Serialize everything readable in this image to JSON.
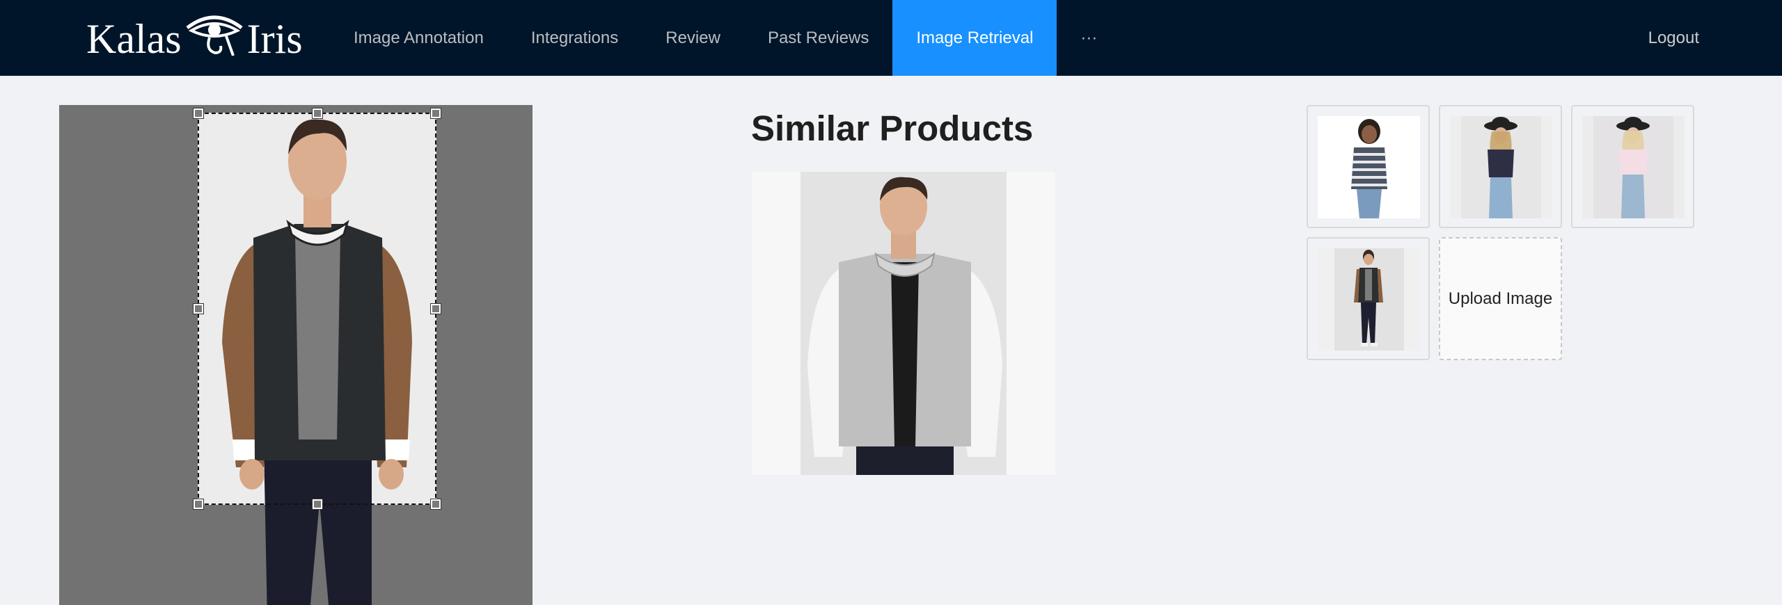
{
  "brand": {
    "name_left": "Kalas",
    "name_right": "Iris"
  },
  "nav": {
    "items": [
      {
        "label": "Image Annotation",
        "active": false
      },
      {
        "label": "Integrations",
        "active": false
      },
      {
        "label": "Review",
        "active": false
      },
      {
        "label": "Past Reviews",
        "active": false
      },
      {
        "label": "Image Retrieval",
        "active": true
      },
      {
        "label": "···",
        "active": false
      }
    ],
    "logout_label": "Logout"
  },
  "main": {
    "similar_title": "Similar Products",
    "upload_label": "Upload Image"
  },
  "colors": {
    "header_bg": "#001529",
    "accent": "#1890ff",
    "page_bg": "#f0f2f5"
  }
}
